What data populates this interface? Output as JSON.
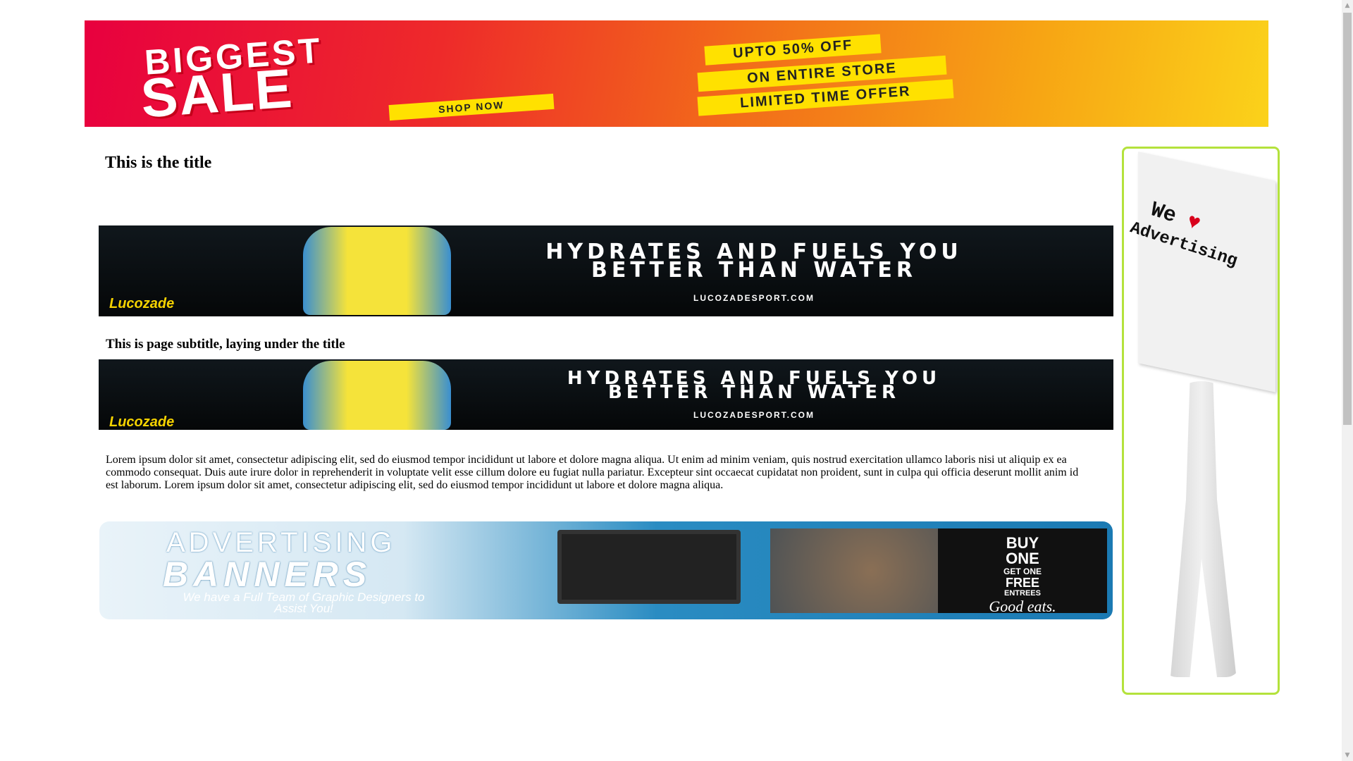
{
  "top_banner": {
    "line1": "BIGGEST",
    "line2": "SALE",
    "cta": "SHOP NOW",
    "offer1": "UPTO 50% OFF",
    "offer2": "ON ENTIRE STORE",
    "offer3": "LIMITED TIME OFFER"
  },
  "page": {
    "title": "This is the title",
    "subtitle": "This is page subtitle, laying under the title",
    "body": "Lorem ipsum dolor sit amet, consectetur adipiscing elit, sed do eiusmod tempor incididunt ut labore et dolore magna aliqua. Ut enim ad minim veniam, quis nostrud exercitation ullamco laboris nisi ut aliquip ex ea commodo consequat. Duis aute irure dolor in reprehenderit in voluptate velit esse cillum dolore eu fugiat nulla pariatur. Excepteur sint occaecat cupidatat non proident, sunt in culpa qui officia deserunt mollit anim id est laborum. Lorem ipsum dolor sit amet, consectetur adipiscing elit, sed do eiusmod tempor incididunt ut labore et dolore magna aliqua."
  },
  "lucozade_ad": {
    "headline1": "HYDRATES AND FUELS YOU",
    "headline2": "BETTER THAN WATER",
    "url": "LUCOZADESPORT.COM",
    "logo": "Lucozade"
  },
  "advertising_ad": {
    "line1": "ADVERTISING",
    "line2": "BANNERS",
    "tagline": "We have a Full Team of Graphic Designers to Assist You!",
    "promo1": "BUY",
    "promo2": "ONE",
    "promo3": "GET ONE",
    "promo4": "FREE",
    "promo5": "ENTREES",
    "promo6": "Good eats."
  },
  "side_ad": {
    "line1": "We",
    "heart": "♥",
    "line2": "Advertising"
  },
  "colors": {
    "side_border": "#b4e23c",
    "heart": "#d8001c"
  },
  "scrollbar": {
    "position_fraction": 0
  }
}
